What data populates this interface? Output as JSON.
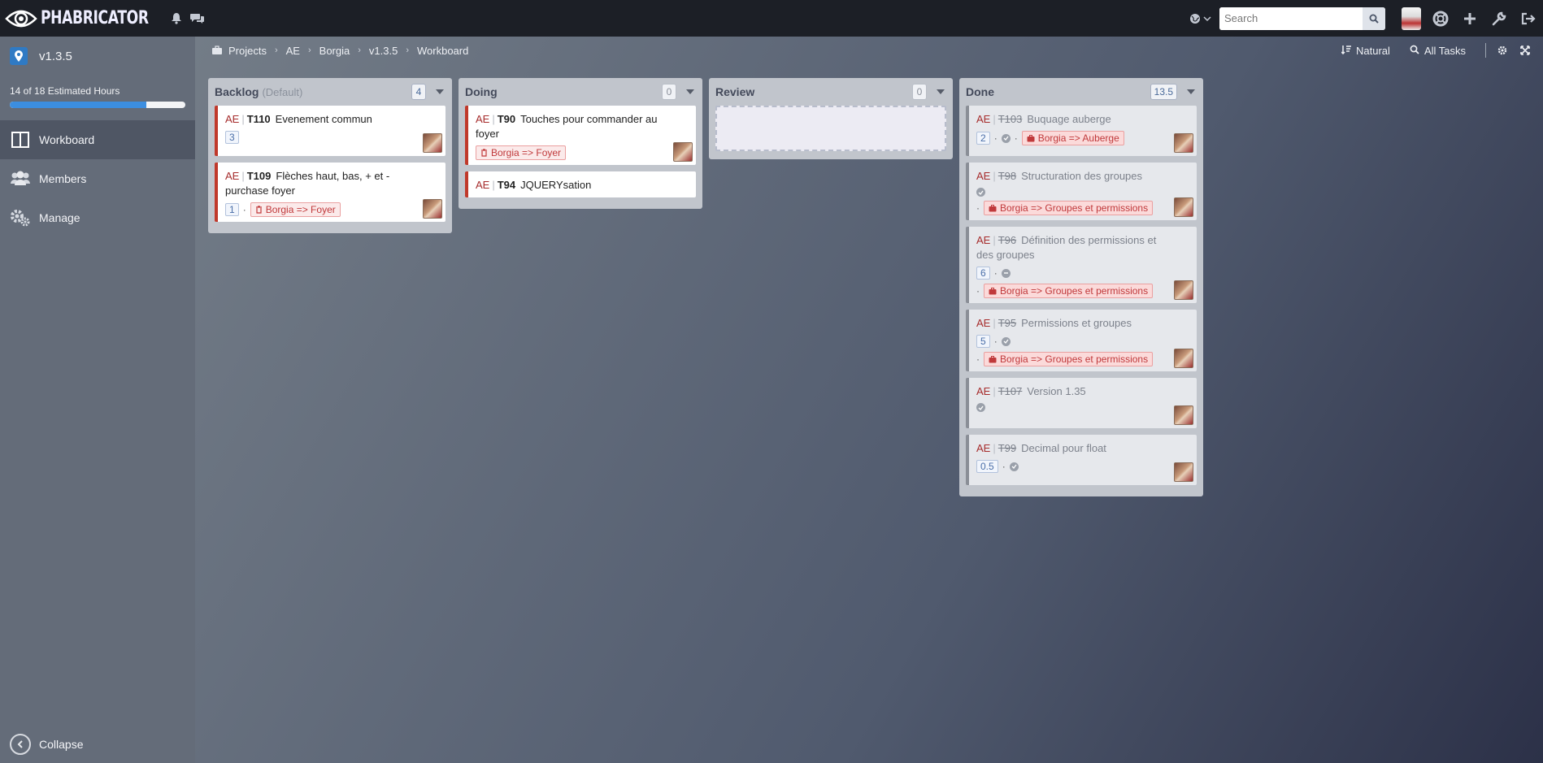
{
  "app": {
    "name": "PHABRICATOR"
  },
  "search": {
    "placeholder": "Search"
  },
  "sidebar": {
    "project_name": "v1.3.5",
    "hours_text": "14 of 18 Estimated Hours",
    "hours_progress": 0.78,
    "items": [
      {
        "label": "Workboard",
        "active": true
      },
      {
        "label": "Members",
        "active": false
      },
      {
        "label": "Manage",
        "active": false
      }
    ],
    "collapse_label": "Collapse"
  },
  "breadcrumb": [
    "Projects",
    "AE",
    "Borgia",
    "v1.3.5",
    "Workboard"
  ],
  "actions": {
    "order_label": "Natural",
    "filter_label": "All Tasks"
  },
  "columns": [
    {
      "title": "Backlog",
      "subtitle": "(Default)",
      "count": "4",
      "cards": [
        {
          "tag": "AE",
          "id": "T110",
          "title": "Evenement commun",
          "points": "3",
          "project": "",
          "done": false
        },
        {
          "tag": "AE",
          "id": "T109",
          "title": "Flèches haut, bas, + et - purchase foyer",
          "points": "1",
          "project": "Borgia => Foyer",
          "done": false
        }
      ]
    },
    {
      "title": "Doing",
      "subtitle": "",
      "count": "0",
      "cards": [
        {
          "tag": "AE",
          "id": "T90",
          "title": "Touches pour commander au foyer",
          "points": "",
          "project": "Borgia => Foyer",
          "done": false
        },
        {
          "tag": "AE",
          "id": "T94",
          "title": "JQUERYsation",
          "points": "",
          "project": "",
          "done": false
        }
      ]
    },
    {
      "title": "Review",
      "subtitle": "",
      "count": "0",
      "cards": []
    },
    {
      "title": "Done",
      "subtitle": "",
      "count": "13.5",
      "cards": [
        {
          "tag": "AE",
          "id": "T103",
          "title": "Buquage auberge",
          "points": "2",
          "project": "Borgia => Auberge",
          "done": true
        },
        {
          "tag": "AE",
          "id": "T98",
          "title": "Structuration des groupes",
          "points": "",
          "project": "Borgia => Groupes et permissions",
          "done": true
        },
        {
          "tag": "AE",
          "id": "T96",
          "title": "Définition des permissions et des groupes",
          "points": "6",
          "project": "Borgia => Groupes et permissions",
          "done": true
        },
        {
          "tag": "AE",
          "id": "T95",
          "title": "Permissions et groupes",
          "points": "5",
          "project": "Borgia => Groupes et permissions",
          "done": true
        },
        {
          "tag": "AE",
          "id": "T107",
          "title": "Version 1.35",
          "points": "",
          "project": "",
          "done": true
        },
        {
          "tag": "AE",
          "id": "T99",
          "title": "Decimal pour float",
          "points": "0.5",
          "project": "",
          "done": true
        }
      ]
    }
  ]
}
